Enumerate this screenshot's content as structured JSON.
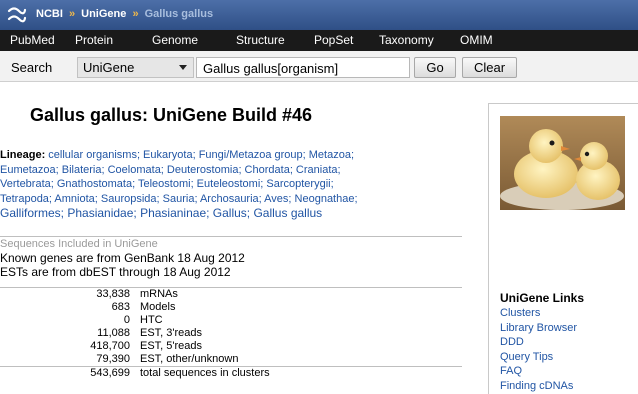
{
  "header": {
    "breadcrumb": {
      "site": "NCBI",
      "sep1": "»",
      "db": "UniGene",
      "sep2": "»",
      "current": "Gallus gallus"
    }
  },
  "nav": {
    "items": [
      "PubMed",
      "Protein",
      "Genome",
      "Structure",
      "PopSet",
      "Taxonomy",
      "OMIM"
    ]
  },
  "search": {
    "label": "Search",
    "database_value": "UniGene",
    "term_value": "Gallus gallus[organism]",
    "go_label": "Go",
    "clear_label": "Clear"
  },
  "main": {
    "title": "Gallus gallus:   UniGene Build #46",
    "lineage": {
      "label": "Lineage:",
      "lines": [
        "cellular organisms; Eukaryota; Fungi/Metazoa group; Metazoa;",
        "Eumetazoa; Bilateria; Coelomata; Deuterostomia; Chordata; Craniata;",
        "Vertebrata; Gnathostomata; Teleostomi; Euteleostomi; Sarcopterygii;",
        "Tetrapoda; Amniota; Sauropsida; Sauria; Archosauria; Aves; Neognathae;",
        "Galliformes; Phasianidae; Phasianinae; Gallus; Gallus gallus"
      ]
    },
    "sequences": {
      "heading": "Sequences Included in UniGene",
      "known_genes": "Known genes are from GenBank 18 Aug 2012",
      "ests": "ESTs are from dbEST through 18 Aug 2012",
      "rows": [
        {
          "count": "33,838",
          "label": "mRNAs"
        },
        {
          "count": "683",
          "label": "Models"
        },
        {
          "count": "0",
          "label": "HTC"
        },
        {
          "count": "11,088",
          "label": "EST, 3'reads"
        },
        {
          "count": "418,700",
          "label": "EST, 5'reads"
        },
        {
          "count": "79,390",
          "label": "EST, other/unknown"
        }
      ],
      "total": {
        "count": "543,699",
        "label": "total sequences in clusters"
      }
    }
  },
  "sidebar": {
    "links_heading": "UniGene Links",
    "links": [
      "Clusters",
      "Library Browser",
      "DDD",
      "Query Tips",
      "FAQ",
      "Finding cDNAs"
    ]
  },
  "colors": {
    "header_blue": "#3b5d96",
    "nav_black": "#1a1a1a",
    "link_blue": "#2155a4",
    "breadcrumb_accent": "#f0b84a"
  }
}
